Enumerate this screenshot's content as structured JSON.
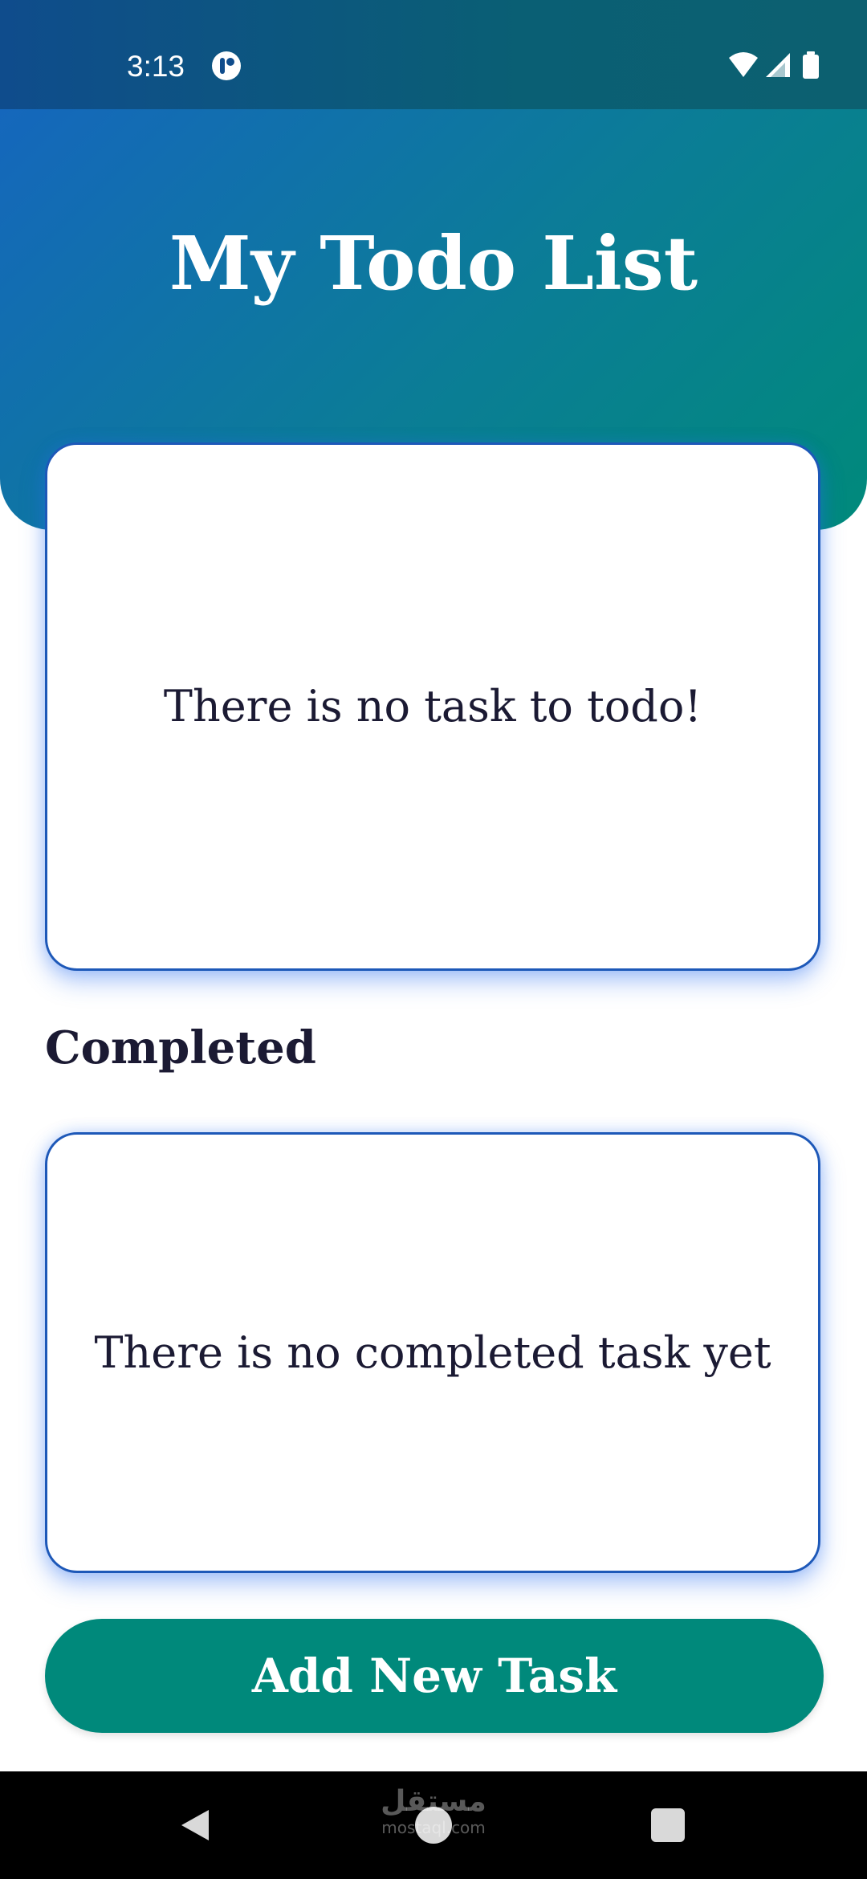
{
  "status_bar": {
    "time": "3:13",
    "icons": [
      "app-notification-icon",
      "wifi-icon",
      "signal-icon",
      "battery-icon"
    ]
  },
  "header": {
    "title": "My Todo List"
  },
  "todo_card": {
    "empty_message": "There is no task to todo!"
  },
  "completed_section": {
    "title": "Completed",
    "empty_message": "There is no completed task yet"
  },
  "add_button": {
    "label": "Add New Task"
  },
  "watermark": {
    "arabic": "مستقل",
    "latin": "mostaql.com"
  },
  "nav_bar": {
    "icons": [
      "back-icon",
      "home-icon",
      "recent-apps-icon"
    ]
  },
  "colors": {
    "header_gradient_start": "#1567bc",
    "header_gradient_end": "#008a7b",
    "card_border": "#1d58b8",
    "primary_button": "#00897b",
    "text_dark": "#1b1a33"
  }
}
